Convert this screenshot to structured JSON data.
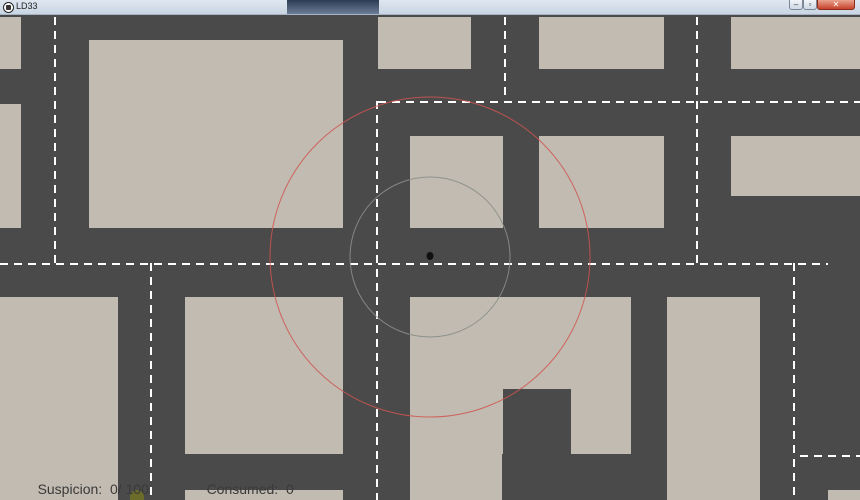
{
  "window": {
    "title": "LD33",
    "minimize_icon": "minimize-icon",
    "maximize_icon": "maximize-icon",
    "close_icon": "close-icon"
  },
  "hud": {
    "suspicion_label": "Suspicion:",
    "suspicion_value": "0/ 100",
    "consumed_label": "Consumed:",
    "consumed_value": "0"
  },
  "colors": {
    "road": "#4a4a4a",
    "building": "#c1bbb1",
    "lane_marking": "#ffffff",
    "detection_radius": "#d0554f",
    "vision_radius": "#8a8f8a",
    "player": "#111111"
  }
}
